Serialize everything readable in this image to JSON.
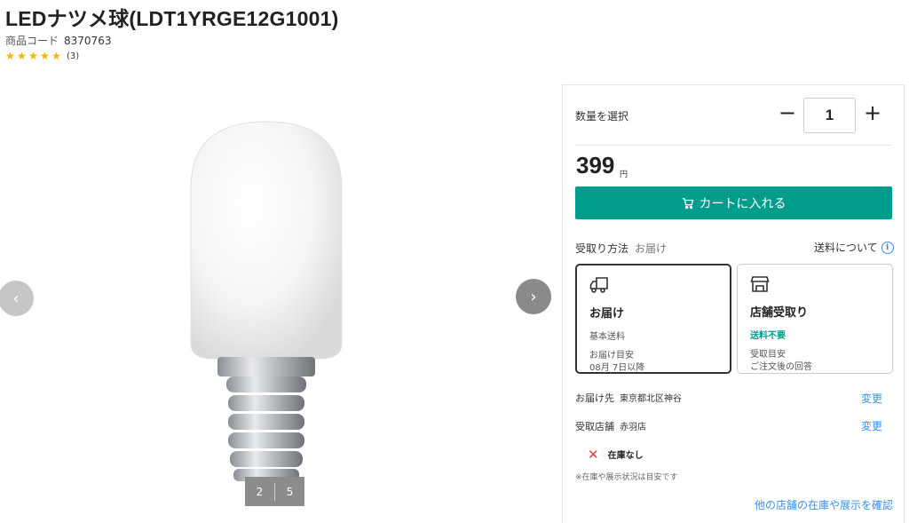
{
  "product": {
    "title": "LEDナツメ球(LDT1YRGE12G1001)",
    "code_label": "商品コード",
    "code_value": "8370763",
    "rating": 5,
    "review_count": "(3)",
    "star_color": "#f5b400"
  },
  "gallery": {
    "current": "2",
    "total": "5",
    "prev_icon": "chevron-left-icon",
    "next_icon": "chevron-right-icon"
  },
  "purchase": {
    "qty_label": "数量を選択",
    "qty_minus": "−",
    "qty_value": "1",
    "qty_plus": "+",
    "price": "399",
    "currency": "円",
    "cart_label": "カートに入れる",
    "accent_color": "#009c8c"
  },
  "receive": {
    "label": "受取り方法",
    "selected": "お届け",
    "shipping_link": "送料について",
    "options": [
      {
        "icon": "truck-icon",
        "title": "お届け",
        "line1": "基本送料",
        "line2": "お届け目安",
        "line3": "08月 7日以降"
      },
      {
        "icon": "store-icon",
        "title": "店舗受取り",
        "line1": "送料不要",
        "line2": "受取目安",
        "line3": "ご注文後の回答"
      }
    ]
  },
  "delivery": {
    "dest_label": "お届け先",
    "dest_value": "東京都北区神谷",
    "dest_change": "変更",
    "store_label": "受取店舗",
    "store_value": "赤羽店",
    "store_change": "変更",
    "stock_status": "在庫なし",
    "note": "※在庫や展示状況は目安です",
    "other_stores_link": "他の店舗の在庫や展示を確認",
    "link_color": "#3a8ee6"
  }
}
